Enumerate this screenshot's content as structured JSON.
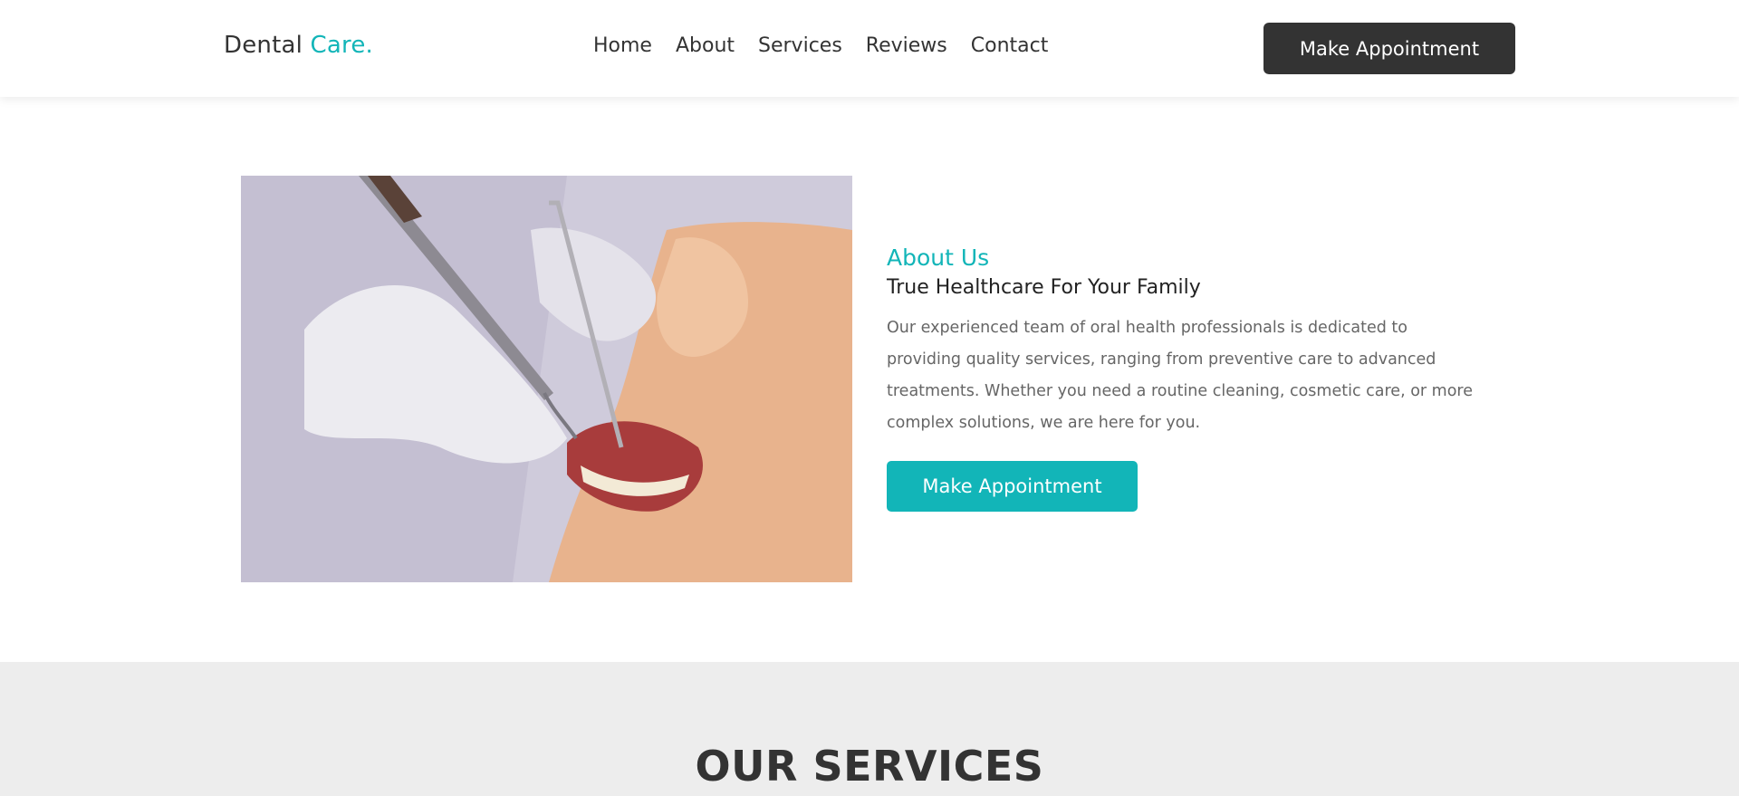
{
  "nav": {
    "logo_main": "Dental",
    "logo_accent": "Care.",
    "links": [
      "Home",
      "About",
      "Services",
      "Reviews",
      "Contact"
    ],
    "cta_label": "Make Appointment"
  },
  "about": {
    "kicker": "About Us",
    "heading": "True Healthcare For Your Family",
    "body": "Our experienced team of oral health professionals is dedicated to providing quality services, ranging from preventive care to advanced treatments. Whether you need a routine cleaning, cosmetic care, or more complex solutions, we are here for you.",
    "cta_label": "Make Appointment",
    "photo_icon": "dental-exam-photo"
  },
  "services": {
    "title": "OUR SERVICES"
  },
  "colors": {
    "accent": "#12b5b8",
    "dark_button": "#333333",
    "services_bg": "#ededed"
  }
}
